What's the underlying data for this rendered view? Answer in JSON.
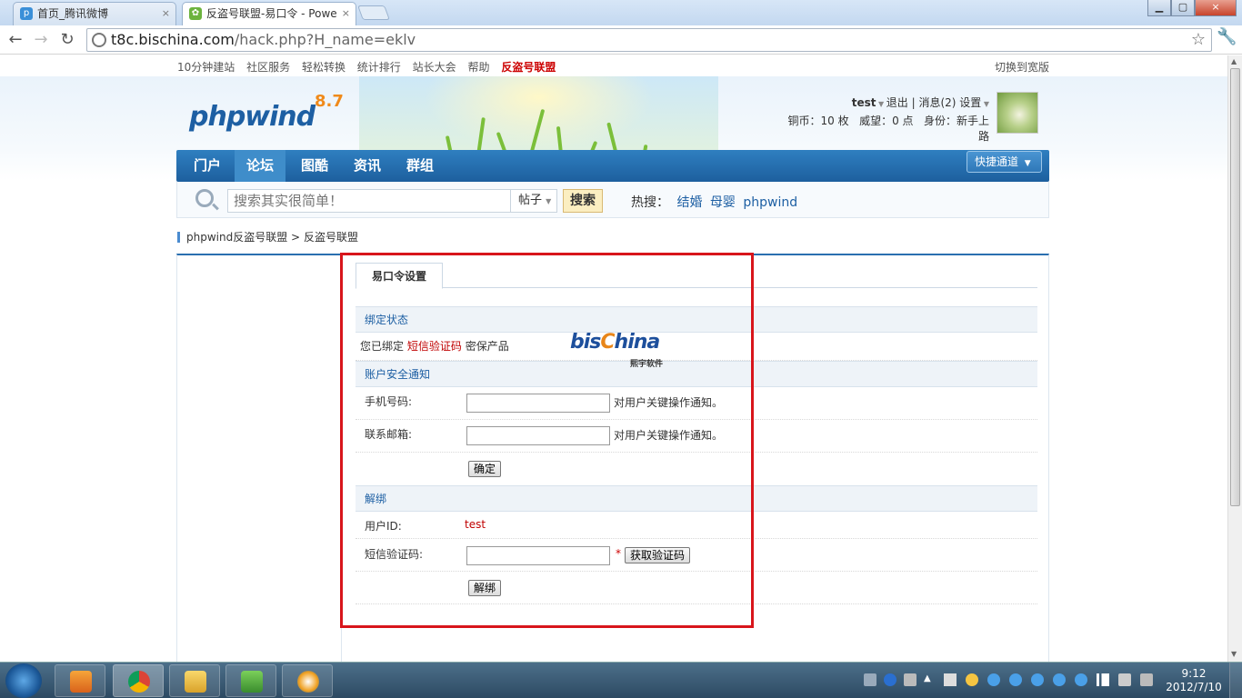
{
  "browser": {
    "tabs": [
      {
        "title": "首页_腾讯微博",
        "active": false
      },
      {
        "title": "反盗号联盟-易口令 - Powe",
        "active": true
      }
    ],
    "url_host": "t8c.bischina.com",
    "url_path": "/hack.php?H_name=eklv",
    "close_glyph": "×"
  },
  "site": {
    "toplinks": [
      "10分钟建站",
      "社区服务",
      "轻松转换",
      "统计排行",
      "站长大会",
      "帮助",
      "反盗号联盟"
    ],
    "wide_version": "切换到宽版",
    "logo_text": "phpwind",
    "logo_version": "8.7",
    "user": {
      "name": "test",
      "logout": "退出",
      "messages": "消息(2)",
      "settings": "设置",
      "coins": "铜币：10 枚",
      "prestige": "威望：0 点",
      "identity": "身份：新手上路"
    },
    "nav": [
      "门户",
      "论坛",
      "图酷",
      "资讯",
      "群组"
    ],
    "nav_active": 1,
    "quick_access": "快捷通道",
    "search": {
      "placeholder": "搜索其实很简单！",
      "type": "帖子",
      "button": "搜索",
      "hot_label": "热搜：",
      "hot_terms": [
        "结婚",
        "母婴",
        "phpwind"
      ]
    },
    "breadcrumb": [
      "phpwind反盗号联盟",
      "反盗号联盟"
    ],
    "breadcrumb_sep": ">"
  },
  "panel": {
    "tab": "易口令设置",
    "bind_section": "绑定状态",
    "bind_status_pre": "您已绑定",
    "bind_status_link": "短信验证码",
    "bind_status_post": "密保产品",
    "notify_section": "账户安全通知",
    "phone_label": "手机号码:",
    "phone_hint": "对用户关键操作通知。",
    "email_label": "联系邮箱:",
    "email_hint": "对用户关键操作通知。",
    "confirm_button": "确定",
    "unbind_section": "解绑",
    "userid_label": "用户ID:",
    "userid_value": "test",
    "sms_label": "短信验证码:",
    "required_mark": "*",
    "get_code_button": "获取验证码",
    "unbind_button": "解绑"
  },
  "watermark": {
    "brand_a": "bis",
    "brand_c": "C",
    "brand_b": "hina",
    "sub": "熙宇软件"
  },
  "taskbar": {
    "time": "9:12",
    "date": "2012/7/10"
  },
  "colors": {
    "accent": "#1d5fa3",
    "highlight_red": "#c00000",
    "frame_red": "#d8151b"
  }
}
